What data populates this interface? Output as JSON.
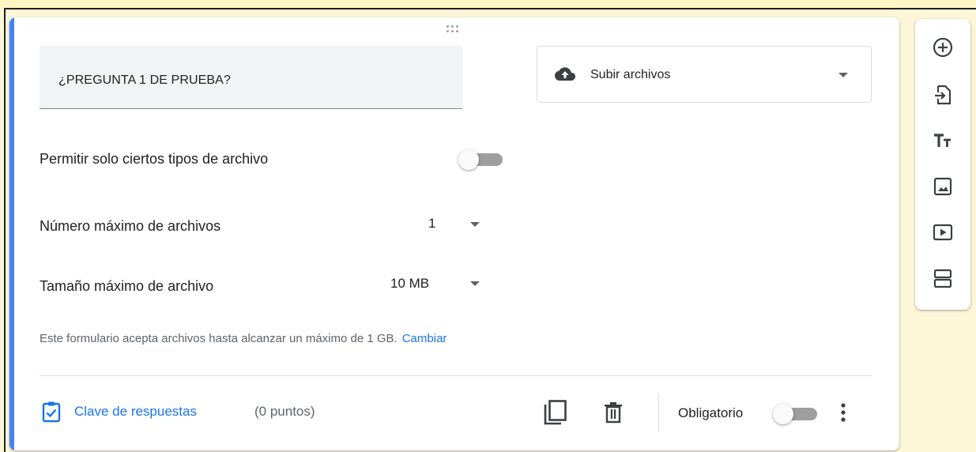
{
  "question": {
    "title": "¿PREGUNTA 1 DE PRUEBA?",
    "type_label": "Subir archivos",
    "type_icon": "cloud-upload-icon"
  },
  "settings": {
    "allow_types_label": "Permitir solo ciertos tipos de archivo",
    "allow_types_enabled": false,
    "max_files_label": "Número máximo de archivos",
    "max_files_value": "1",
    "max_size_label": "Tamaño máximo de archivo",
    "max_size_value": "10 MB",
    "info_text": "Este formulario acepta archivos hasta alcanzar un máximo de 1 GB.",
    "info_link": "Cambiar"
  },
  "footer": {
    "answer_key_label": "Clave de respuestas",
    "points_label": "(0 puntos)",
    "required_label": "Obligatorio",
    "required_enabled": false
  },
  "toolbar": {
    "items": [
      {
        "icon": "add-question-icon"
      },
      {
        "icon": "import-questions-icon"
      },
      {
        "icon": "title-description-icon"
      },
      {
        "icon": "add-image-icon"
      },
      {
        "icon": "add-video-icon"
      },
      {
        "icon": "add-section-icon"
      }
    ]
  },
  "colors": {
    "accent": "#4285f4",
    "link": "#1a73e8",
    "background": "#fdf6d8"
  }
}
